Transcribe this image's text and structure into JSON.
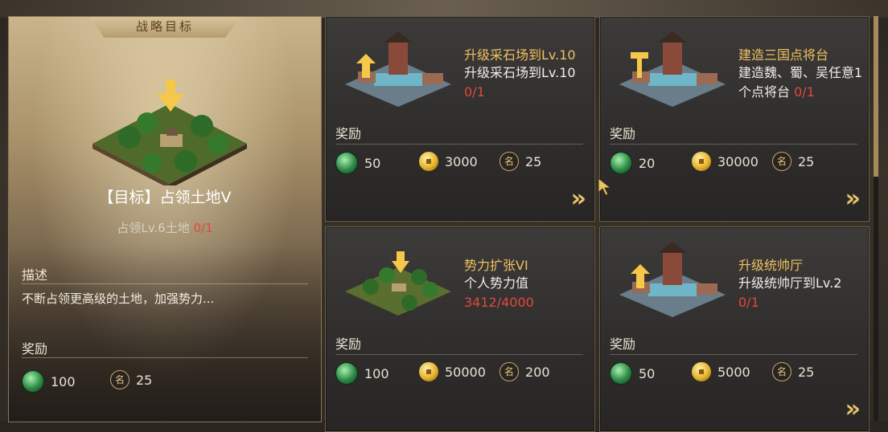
{
  "left_panel": {
    "tab_title": "战略目标",
    "goal_title": "【目标】占领土地V",
    "goal_condition": "占领Lv.6土地",
    "goal_progress": "0/1",
    "desc_label": "描述",
    "desc_text": "不断占领更高级的土地，加强势力...",
    "reward_label": "奖励",
    "rewards": [
      {
        "icon": "jade-icon",
        "value": "100"
      },
      {
        "icon": "fame-icon",
        "value": "25"
      }
    ]
  },
  "cards": [
    {
      "title": "升级采石场到Lv.10",
      "desc": "升级采石场到Lv.10",
      "progress": "0/1",
      "reward_label": "奖励",
      "rewards": [
        "50",
        "3000",
        "25"
      ]
    },
    {
      "title": "建造三国点将台",
      "desc": "建造魏、蜀、吴任意1个点将台",
      "progress": "0/1",
      "reward_label": "奖励",
      "rewards": [
        "20",
        "30000",
        "25"
      ]
    },
    {
      "title": "势力扩张VI",
      "desc": "个人势力值",
      "progress": "3412/4000",
      "reward_label": "奖励",
      "rewards": [
        "100",
        "50000",
        "200"
      ]
    },
    {
      "title": "升级统帅厅",
      "desc": "升级统帅厅到Lv.2",
      "progress": "0/1",
      "reward_label": "奖励",
      "rewards": [
        "50",
        "5000",
        "25"
      ]
    }
  ],
  "icons": {
    "jade": "jade-icon",
    "coin": "coin-icon",
    "fame": "fame-icon",
    "fame_glyph": "名",
    "go": "»"
  },
  "colors": {
    "title_gold": "#f0c060",
    "progress_red": "#e0483c"
  }
}
